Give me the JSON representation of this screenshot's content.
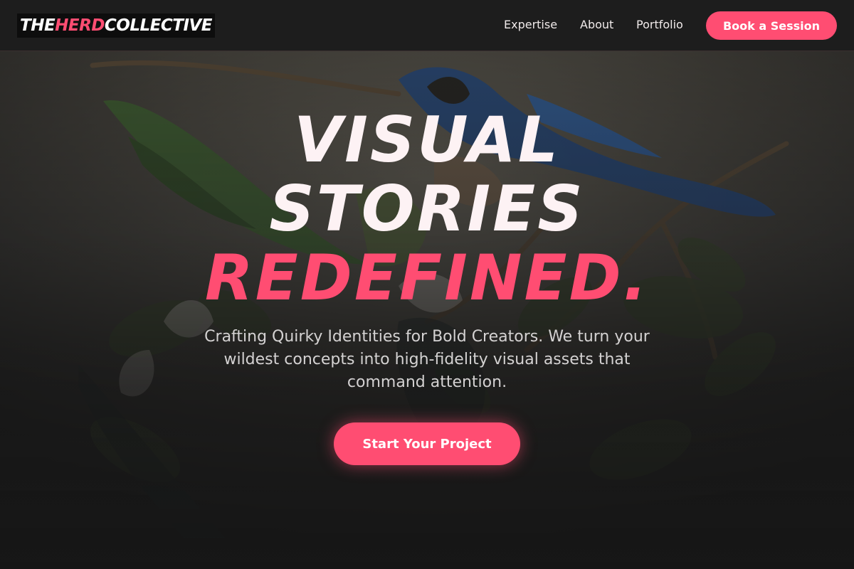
{
  "brand": {
    "part1": "THE ",
    "part2": "HERD",
    "part3": " COLLECTIVE"
  },
  "nav": {
    "links": [
      {
        "label": "Expertise"
      },
      {
        "label": "About"
      },
      {
        "label": "Portfolio"
      }
    ],
    "cta_label": "Book a Session"
  },
  "hero": {
    "headline_line1": "VISUAL",
    "headline_line2": "STORIES",
    "headline_line3": "REDEFINED.",
    "subtext": "Crafting Quirky Identities for Bold Creators. We turn your wildest concepts into high-fidelity visual assets that command attention.",
    "cta_label": "Start Your Project",
    "background_image": "illustration-birds-on-branch"
  },
  "colors": {
    "accent": "#ff4d72",
    "background": "#161616",
    "navbar": "#1d1d1d",
    "headline": "#fdf2f4"
  }
}
